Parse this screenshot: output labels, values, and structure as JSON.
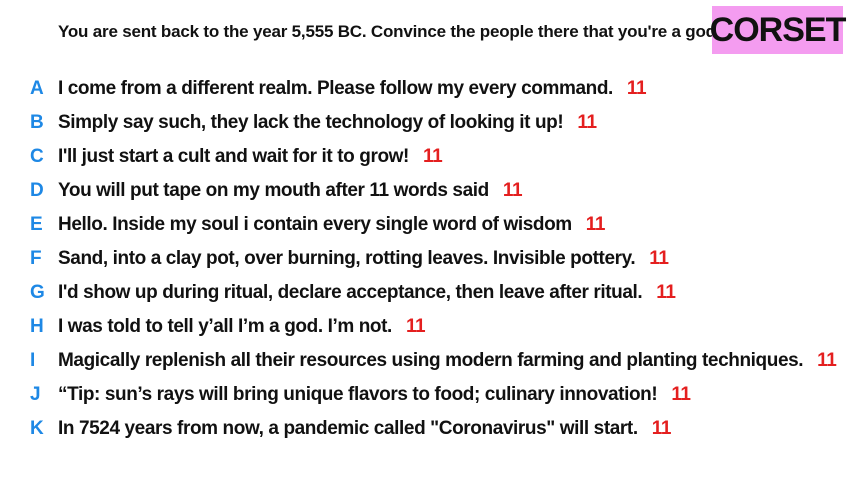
{
  "prompt": "You are sent back to the year 5,555 BC. Convince the people there that you're a god.",
  "brand": "CORSET",
  "colors": {
    "brand_background": "#f49cf0",
    "letter": "#1e88e5",
    "score": "#e41f1f"
  },
  "answers": [
    {
      "letter": "A",
      "text": "I come from a different realm. Please follow my every command.",
      "score": "11"
    },
    {
      "letter": "B",
      "text": "Simply say such, they lack the technology of looking it up!",
      "score": "11"
    },
    {
      "letter": "C",
      "text": "I'll just start a cult and wait for it to grow!",
      "score": "11"
    },
    {
      "letter": "D",
      "text": "You will put tape on my mouth after 11 words said",
      "score": "11"
    },
    {
      "letter": "E",
      "text": "Hello. Inside my soul i contain every single word of wisdom",
      "score": "11"
    },
    {
      "letter": "F",
      "text": "Sand, into a clay pot, over burning, rotting leaves. Invisible pottery.",
      "score": "11"
    },
    {
      "letter": "G",
      "text": "I'd show up during ritual, declare acceptance, then leave after ritual.",
      "score": "11"
    },
    {
      "letter": "H",
      "text": "I was told to tell y’all I’m a god. I’m not.",
      "score": "11"
    },
    {
      "letter": "I",
      "text": "Magically replenish all their resources using modern farming and planting techniques.",
      "score": "11"
    },
    {
      "letter": "J",
      "text": "“Tip: sun’s rays will bring unique flavors to food; culinary innovation!",
      "score": "11"
    },
    {
      "letter": "K",
      "text": "In 7524 years from now, a pandemic called \"Coronavirus\" will start.",
      "score": "11"
    }
  ]
}
